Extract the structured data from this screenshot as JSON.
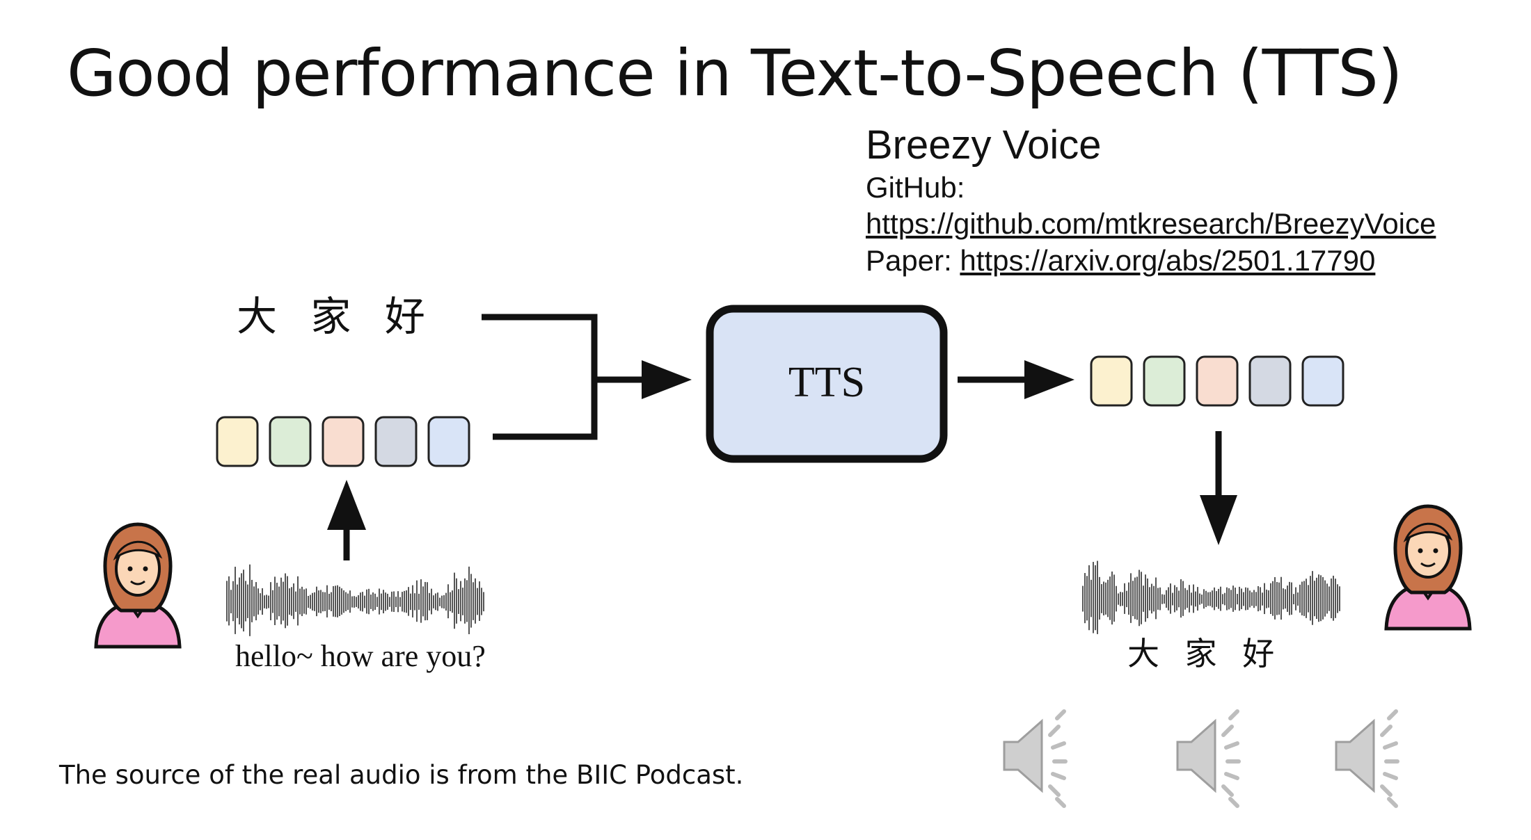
{
  "title": "Good performance in Text-to-Speech (TTS)",
  "model": {
    "name": "Breezy Voice",
    "github_label": "GitHub:",
    "github_url": "https://github.com/mtkresearch/BreezyVoice",
    "paper_label": "Paper:",
    "paper_url": "https://arxiv.org/abs/2501.17790"
  },
  "diagram": {
    "input_text": "大 家 好",
    "box_label": "TTS",
    "speech_text": "hello~ how are you?",
    "output_text": "大 家 好",
    "token_colors": [
      "#FCF1CF",
      "#DCEDD7",
      "#F9DDD0",
      "#D4D9E3",
      "#D9E4F7"
    ],
    "box_fill": "#D9E3F5",
    "waveform_color": "#555555"
  },
  "icons": {
    "speaker": "person-icon",
    "sound": "speaker-sound-icon"
  },
  "footer": {
    "source_note": "The source of the real audio is from the BIIC Podcast."
  }
}
